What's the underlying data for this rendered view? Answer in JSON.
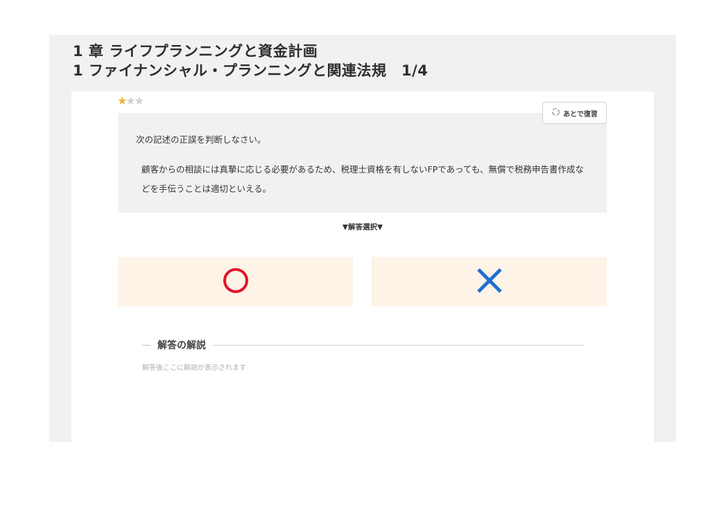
{
  "header": {
    "chapter_title": "1 章 ライフプランニングと資金計画",
    "section_title": "1 ファイナンシャル・プランニングと関連法規　1/4"
  },
  "difficulty": {
    "filled_stars": 1,
    "total_stars": 3,
    "filled_color": "#f2b233",
    "empty_color": "#cfcfcf"
  },
  "review_button": {
    "label": "あとで復習",
    "icon": "recycle-icon"
  },
  "question": {
    "instruction": "次の記述の正誤を判断しなさい。",
    "statement": "顧客からの相談には真摯に応じる必要があるため、税理士資格を有しないFPであっても、無償で税務申告書作成などを手伝うことは適切といえる。"
  },
  "answer_select": {
    "label": "▼解答選択▼",
    "options": [
      {
        "icon": "circle-icon",
        "color": "#e0142a"
      },
      {
        "icon": "cross-icon",
        "color": "#1f6fd1"
      }
    ],
    "option_bg": "#fdf3e7"
  },
  "explanation": {
    "title": "解答の解説",
    "placeholder": "解答後ここに解説が表示されます"
  }
}
